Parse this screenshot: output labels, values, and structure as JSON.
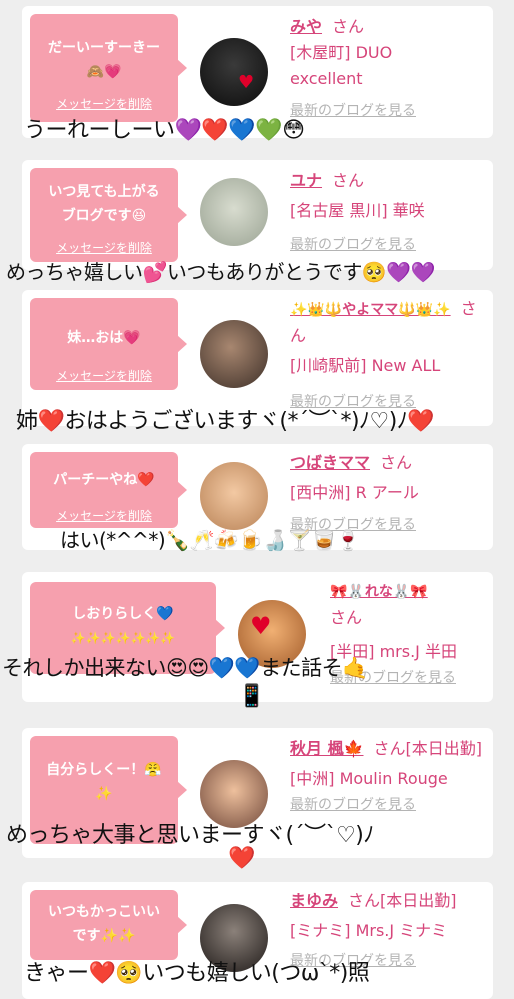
{
  "delete_label": "メッセージを削除",
  "blog_label": "最新のブログを見る",
  "san": "さん",
  "threads": [
    {
      "bubble_lines": [
        "だーいーすーきー",
        "🙈💗"
      ],
      "name": "みや",
      "shop": "[木屋町] DUO excellent",
      "reply": "うーれーしーい💜❤️💙💚😳"
    },
    {
      "bubble_lines": [
        "いつ見ても上がる",
        "ブログです😆"
      ],
      "name": "ユナ",
      "shop": "[名古屋 黒川] 華咲",
      "reply": "めっちゃ嬉しい💕いつもありがとうです🥺💜💜"
    },
    {
      "bubble_lines": [
        "妹…おは💗"
      ],
      "name": "✨👑🔱やよママ🔱👑✨",
      "shop": "[川崎駅前] New ALL",
      "reply": "姉❤️おはようございますヾ(*´︶`*)ﾉ♡)ﾉ❤️"
    },
    {
      "bubble_lines": [
        "パーチーやね❤️"
      ],
      "name": "つばきママ",
      "shop": "[西中洲] R アール",
      "reply": "はい(*^^*)🍾🥂🍻🍺🍶🍸🥃🍷"
    },
    {
      "bubble_lines": [
        "しおりらしく💙",
        "✨✨✨✨✨✨✨"
      ],
      "name": "🎀🐰れな🐰🎀",
      "shop": "[半田] mrs.J 半田",
      "reply": "それしか出来ない😍😍💙💙また話そ🤙",
      "reply2": "📱"
    },
    {
      "bubble_lines": [
        "自分らしくー！😤",
        "✨"
      ],
      "name": "秋月 楓🍁",
      "status": "[本日出勤]",
      "shop": "[中洲] Moulin Rouge",
      "reply": "めっちゃ大事と思いまーすヾ(´︶`♡)ﾉ",
      "reply2": "❤️"
    },
    {
      "bubble_lines": [
        "いつもかっこいい",
        "です✨✨"
      ],
      "name": "まゆみ",
      "status": "[本日出勤]",
      "shop": "[ミナミ] Mrs.J ミナミ",
      "reply": "きゃー❤️🥺いつも嬉しい(つω`*)照"
    }
  ]
}
